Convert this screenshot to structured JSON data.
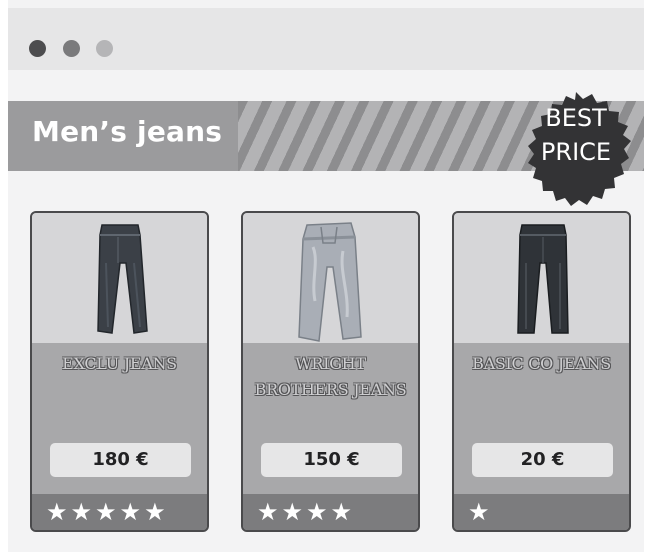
{
  "window": {
    "controls": [
      "dot-dark",
      "dot-medium",
      "dot-light"
    ]
  },
  "banner": {
    "title": "Men’s jeans"
  },
  "badge": {
    "line1": "BEST",
    "line2": "PRICE"
  },
  "products": [
    {
      "name": "EXCLU JEANS",
      "price": "180 €",
      "rating": 5,
      "rating_max": 5,
      "stars": "★★★★★"
    },
    {
      "name": "WRIGHT BROTHERS JEANS",
      "price": "150 €",
      "rating": 4,
      "rating_max": 5,
      "stars": "★★★★"
    },
    {
      "name": "BASIC CO JEANS",
      "price": "20 €",
      "rating": 1,
      "rating_max": 5,
      "stars": "★"
    }
  ],
  "colors": {
    "banner": "#9b9b9d",
    "badge": "#333335",
    "card_body": "#a8a8aa",
    "star_bar": "#7c7c7e"
  }
}
